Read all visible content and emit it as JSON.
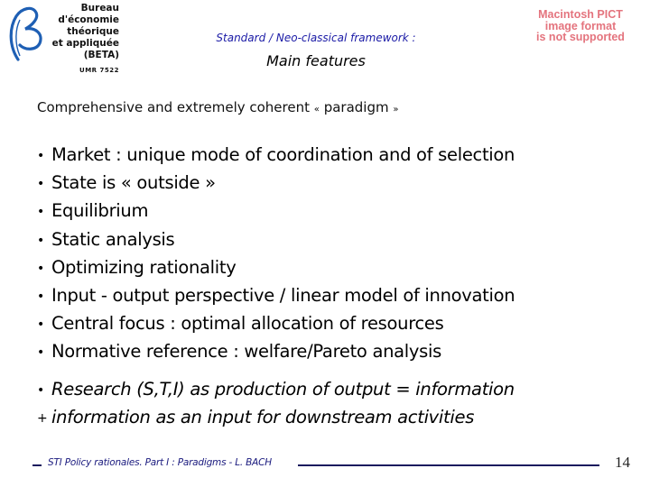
{
  "logo": {
    "lines": [
      "Bureau",
      "d'économie",
      "théorique",
      "et appliquée",
      "(BETA)"
    ],
    "umr": "UMR 7522",
    "icon": "beta-logo-icon",
    "color": "#1e5fb4"
  },
  "placeholder_image": {
    "lines": [
      "Macintosh PICT",
      "image format",
      "is not supported"
    ],
    "color": "#e4747e"
  },
  "header": {
    "subtitle": "Standard / Neo-classical framework :",
    "title": "Main features"
  },
  "intro": {
    "text": "Comprehensive and extremely coherent",
    "open_quote": "«",
    "word": "paradigm",
    "close_quote": "»"
  },
  "bullets": [
    {
      "marker": "•",
      "text": "Market : unique mode of coordination and of selection"
    },
    {
      "marker": "•",
      "text": "State is « outside »"
    },
    {
      "marker": "•",
      "text": "Equilibrium"
    },
    {
      "marker": "•",
      "text": "Static analysis"
    },
    {
      "marker": "•",
      "text": "Optimizing rationality"
    },
    {
      "marker": "•",
      "text": "Input - output perspective / linear model of innovation"
    },
    {
      "marker": "•",
      "text": "Central focus : optimal allocation of resources"
    },
    {
      "marker": "•",
      "text": "Normative reference : welfare/Pareto analysis"
    }
  ],
  "research": [
    {
      "marker": "•",
      "text": "Research (S,T,I) as production of output = information"
    },
    {
      "marker": "+",
      "text": "information as an input for downstream activities"
    }
  ],
  "footer": {
    "text": "STI Policy rationales. Part I : Paradigms - L. BACH",
    "page_number": "14",
    "color": "#1a1a5e"
  }
}
